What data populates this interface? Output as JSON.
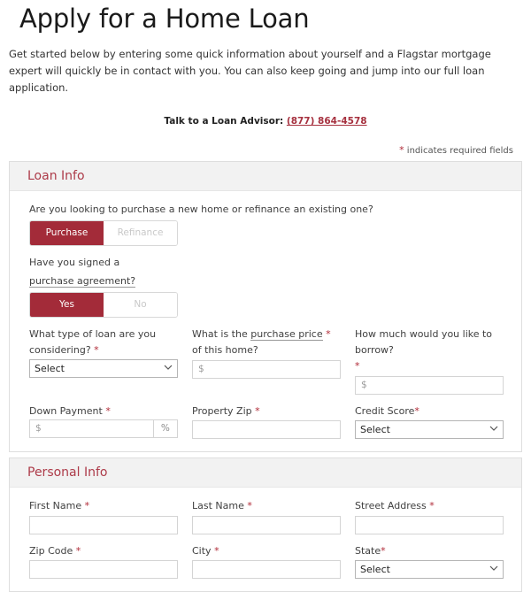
{
  "page": {
    "title": "Apply for a Home Loan",
    "intro": "Get started below by entering some quick information about yourself and a Flagstar mortgage expert will quickly be in contact with you. You can also keep going and jump into our full loan application.",
    "advisor_label": "Talk to a Loan Advisor:",
    "advisor_phone": "(877) 864-4578",
    "required_asterisk": "*",
    "required_note": "indicates required fields"
  },
  "colors": {
    "brand_red": "#a32b39",
    "heading_red": "#ad3b49",
    "link_red": "#a6313f",
    "section_bg": "#f2f2f2",
    "border": "#dedede"
  },
  "loan_info": {
    "heading": "Loan Info",
    "purchase_question": "Are you looking to purchase a new home or refinance an existing one?",
    "purchase_toggle": {
      "options": [
        "Purchase",
        "Refinance"
      ],
      "selected": "Purchase"
    },
    "agreement_question_line1": "Have you signed a",
    "agreement_question_line2": "purchase agreement?",
    "agreement_toggle": {
      "options": [
        "Yes",
        "No"
      ],
      "selected": "Yes"
    },
    "loan_type": {
      "label_line1": "What type of loan are you",
      "label_line2": "considering?",
      "required": "*",
      "value": "Select",
      "options": [
        "Select"
      ]
    },
    "purchase_price": {
      "label_part1": "What is the ",
      "label_tip": "purchase price",
      "required": "*",
      "label_line2": "of this home?",
      "value": "",
      "placeholder": "$"
    },
    "borrow_amount": {
      "label": "How much would you like to borrow?",
      "required": "*",
      "value": "",
      "placeholder": "$"
    },
    "down_payment": {
      "label": "Down Payment",
      "required": "*",
      "value": "",
      "placeholder": "$",
      "suffix": "%"
    },
    "property_zip": {
      "label": "Property Zip",
      "required": "*",
      "value": "",
      "placeholder": ""
    },
    "credit_score": {
      "label": "Credit Score",
      "required": "*",
      "value": "Select",
      "options": [
        "Select"
      ]
    }
  },
  "personal_info": {
    "heading": "Personal Info",
    "first_name": {
      "label": "First Name",
      "required": "*",
      "value": "",
      "placeholder": ""
    },
    "last_name": {
      "label": "Last Name",
      "required": "*",
      "value": "",
      "placeholder": ""
    },
    "street_address": {
      "label": "Street Address",
      "required": "*",
      "value": "",
      "placeholder": ""
    },
    "zip_code": {
      "label": "Zip Code",
      "required": "*",
      "value": "",
      "placeholder": ""
    },
    "city": {
      "label": "City",
      "required": "*",
      "value": "",
      "placeholder": ""
    },
    "state": {
      "label": "State",
      "required": "*",
      "value": "Select",
      "options": [
        "Select"
      ]
    }
  }
}
